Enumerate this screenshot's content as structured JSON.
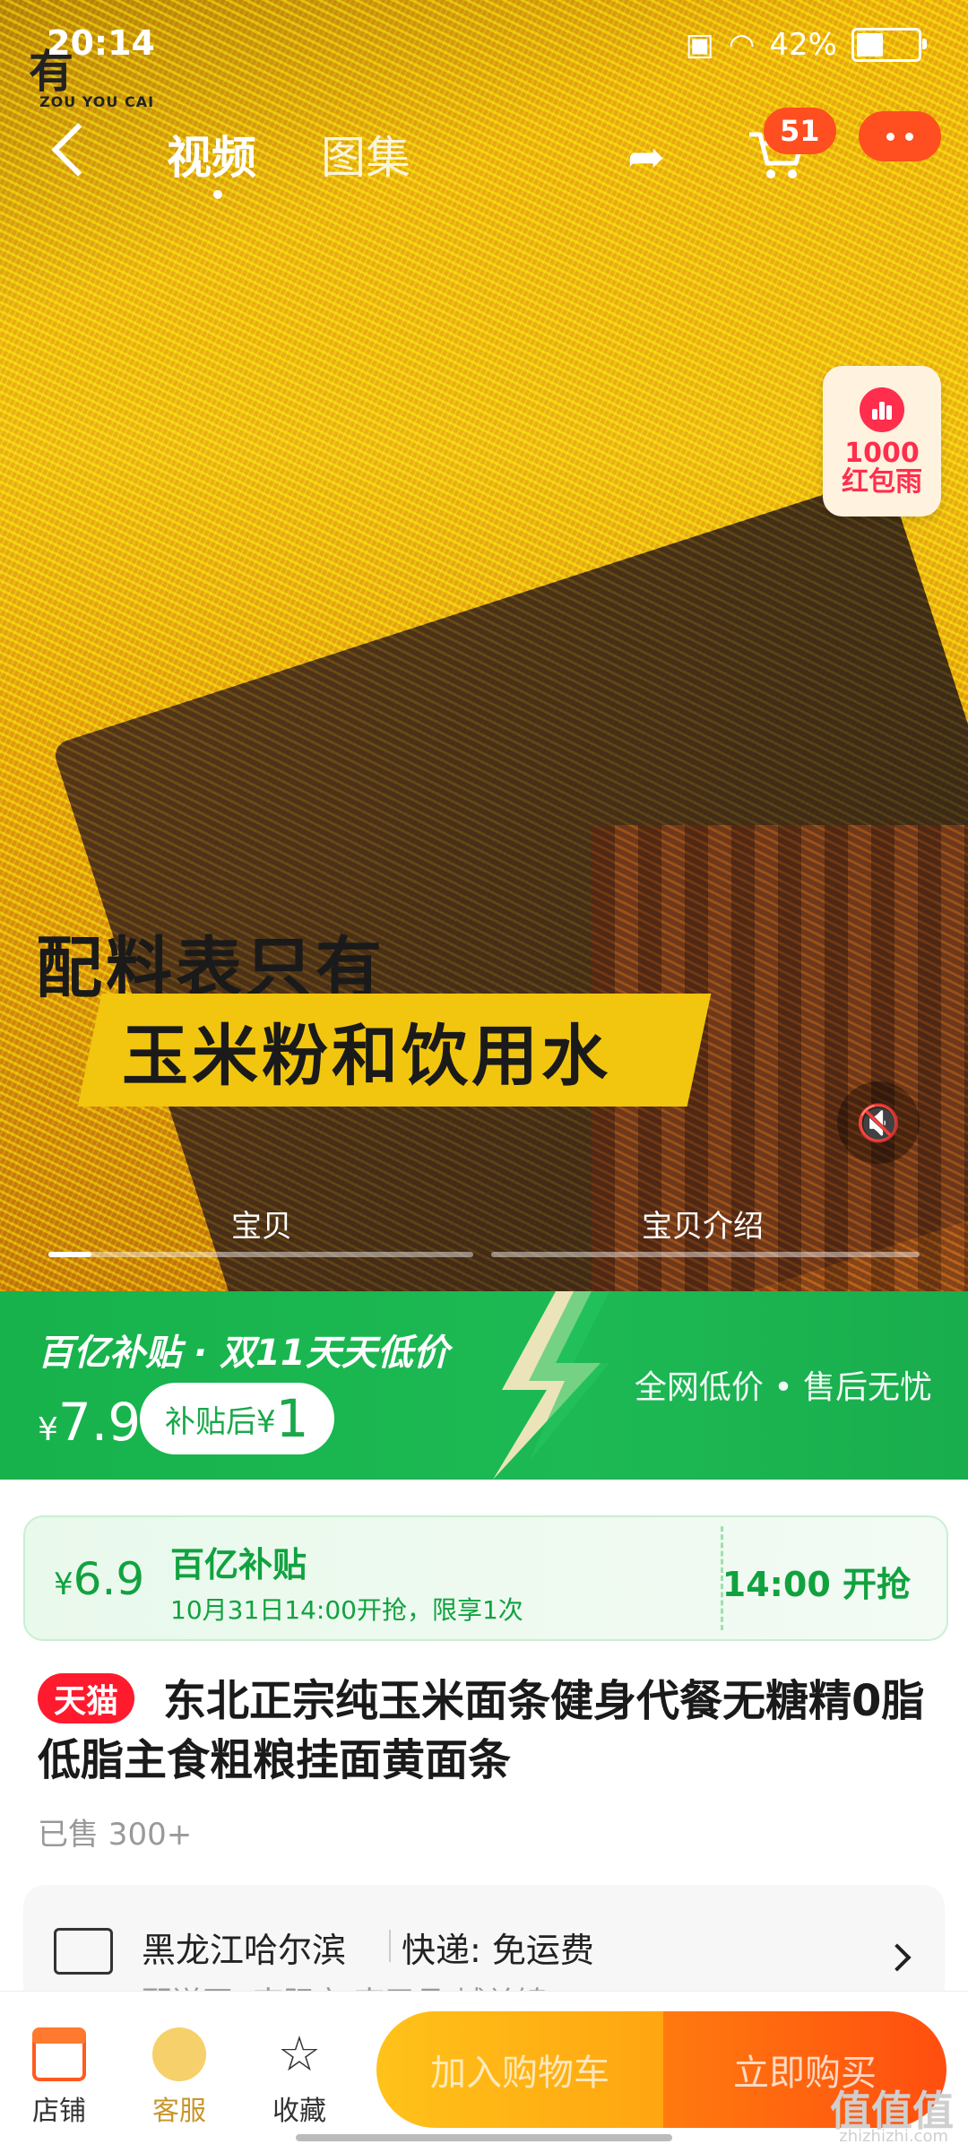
{
  "status": {
    "time": "20:14",
    "battery": "42%"
  },
  "logo": {
    "main": "有",
    "sub": "ZOU YOU CAI"
  },
  "topbar": {
    "tab_video": "视频",
    "tab_gallery": "图集",
    "cart_count": "51"
  },
  "red_rain": {
    "count": "1000",
    "label": "红包雨"
  },
  "overlay": {
    "line1": "配料表只有",
    "line2": "玉米粉和饮用水"
  },
  "segments": {
    "left": "宝贝",
    "right": "宝贝介绍"
  },
  "subsidy_banner": {
    "title": "百亿补贴 · 双11天天低价",
    "currency": "¥",
    "price": "7.9",
    "after_label": "补贴后¥",
    "after_value": "1",
    "right_text": "全网低价 • 售后无忧"
  },
  "coupon": {
    "currency": "¥",
    "price": "6.9",
    "title": "百亿补贴",
    "subtitle": "10月31日14:00开抢，限享1次",
    "time_label": "14:00 开抢"
  },
  "product": {
    "badge": "天猫",
    "title": "东北正宗纯玉米面条健身代餐无糖精0脂低脂主食粗粮挂面黄面条",
    "sold": "已售 300+"
  },
  "shipping": {
    "location": "黑龙江哈尔滨",
    "express": "快递: 免运费",
    "sub": "配送至: 南阳市 南召县 城关镇"
  },
  "bottom": {
    "shop": "店铺",
    "service": "客服",
    "favorite": "收藏",
    "add_cart": "加入购物车",
    "buy_now": "立即购买"
  },
  "watermark": {
    "main": "值值值",
    "sub": "zhizhizhi.com"
  },
  "colors": {
    "green": "#1db954",
    "orange": "#ff4e1f",
    "tmall_red": "#ff1a2e",
    "coupon_green": "#11a23f"
  }
}
